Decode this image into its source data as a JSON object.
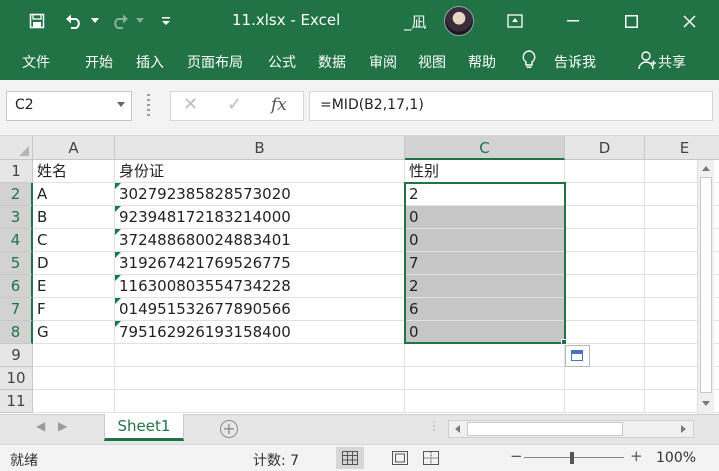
{
  "window": {
    "title": "11.xlsx  -  Excel",
    "user": "_凪"
  },
  "ribbon": {
    "tabs": [
      "文件",
      "开始",
      "插入",
      "页面布局",
      "公式",
      "数据",
      "审阅",
      "视图",
      "帮助",
      "告诉我",
      "共享"
    ]
  },
  "formula_bar": {
    "name_box": "C2",
    "fx": "fx",
    "formula": "=MID(B2,17,1)"
  },
  "grid": {
    "columns": [
      "A",
      "B",
      "C",
      "D",
      "E"
    ],
    "rows": [
      "1",
      "2",
      "3",
      "4",
      "5",
      "6",
      "7",
      "8",
      "9",
      "10",
      "11"
    ],
    "cells": [
      [
        "姓名",
        "身份证",
        "性别"
      ],
      [
        "A",
        "302792385828573020",
        "2"
      ],
      [
        "B",
        "923948172183214000",
        "0"
      ],
      [
        "C",
        "372488680024883401",
        "0"
      ],
      [
        "D",
        "319267421769526775",
        "7"
      ],
      [
        "E",
        "116300803554734228",
        "2"
      ],
      [
        "F",
        "014951532677890566",
        "6"
      ],
      [
        "G",
        "795162926193158400",
        "0"
      ]
    ]
  },
  "sheets": {
    "active": "Sheet1",
    "add": "+"
  },
  "status": {
    "ready": "就绪",
    "count": "计数: 7",
    "zoom": "100%"
  },
  "colors": {
    "brand": "#217346",
    "selection_fill": "#c6c6c6"
  }
}
